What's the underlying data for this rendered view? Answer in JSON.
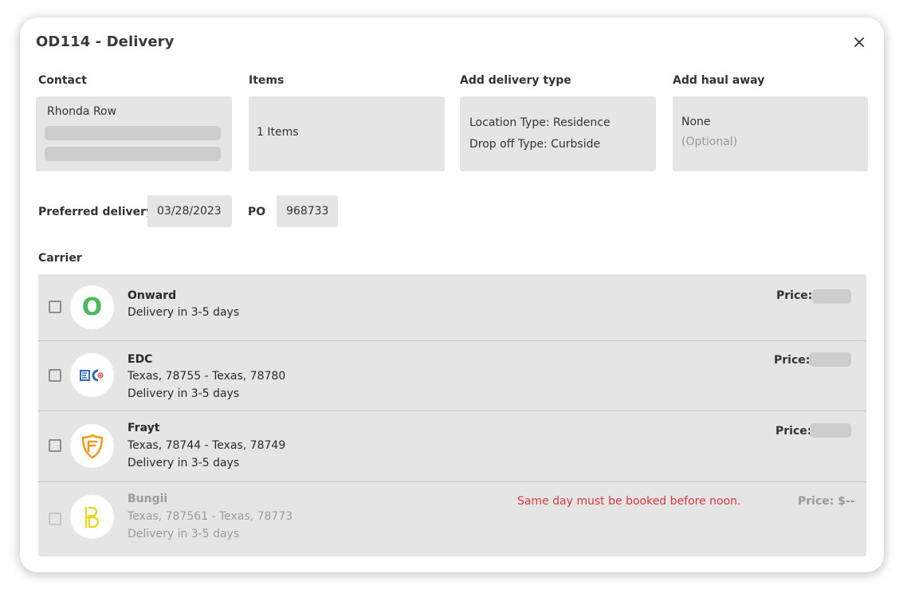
{
  "modal": {
    "title": "OD114 - Delivery"
  },
  "contact": {
    "label": "Contact",
    "name": "Rhonda Row"
  },
  "items": {
    "label": "Items",
    "value": "1 Items"
  },
  "delivery_type": {
    "label": "Add delivery type",
    "location": "Location Type: Residence",
    "dropoff": "Drop off Type: Curbside"
  },
  "haul_away": {
    "label": "Add haul away",
    "value": "None",
    "hint": "(Optional)"
  },
  "preferred": {
    "label": "Preferred delivery",
    "date": "03/28/2023"
  },
  "po": {
    "label": "PO",
    "value": "968733"
  },
  "carrier": {
    "label": "Carrier",
    "list": [
      {
        "name": "Onward",
        "route": "",
        "eta": "Delivery in 3-5 days",
        "price_label": "Price:",
        "price": "",
        "note": "",
        "disabled": false
      },
      {
        "name": "EDC",
        "route": "Texas, 78755 - Texas, 78780",
        "eta": "Delivery in 3-5 days",
        "price_label": "Price:",
        "price": "",
        "note": "",
        "disabled": false
      },
      {
        "name": "Frayt",
        "route": "Texas, 78744 - Texas, 78749",
        "eta": "Delivery in 3-5 days",
        "price_label": "Price:",
        "price": "",
        "note": "",
        "disabled": false
      },
      {
        "name": "Bungii",
        "route": "Texas, 787561 - Texas, 78773",
        "eta": "Delivery in 3-5 days",
        "price_label": "Price: $--",
        "price": "",
        "note": "Same day must be booked before noon.",
        "disabled": true
      }
    ]
  },
  "logo_text": {
    "onward": "O"
  },
  "colors": {
    "onward_green": "#4cb85c",
    "edc_blue": "#2f6db5",
    "frayt_orange": "#f29a1f",
    "bungii_yellow": "#e8d515",
    "warning_red": "#d9363e"
  }
}
